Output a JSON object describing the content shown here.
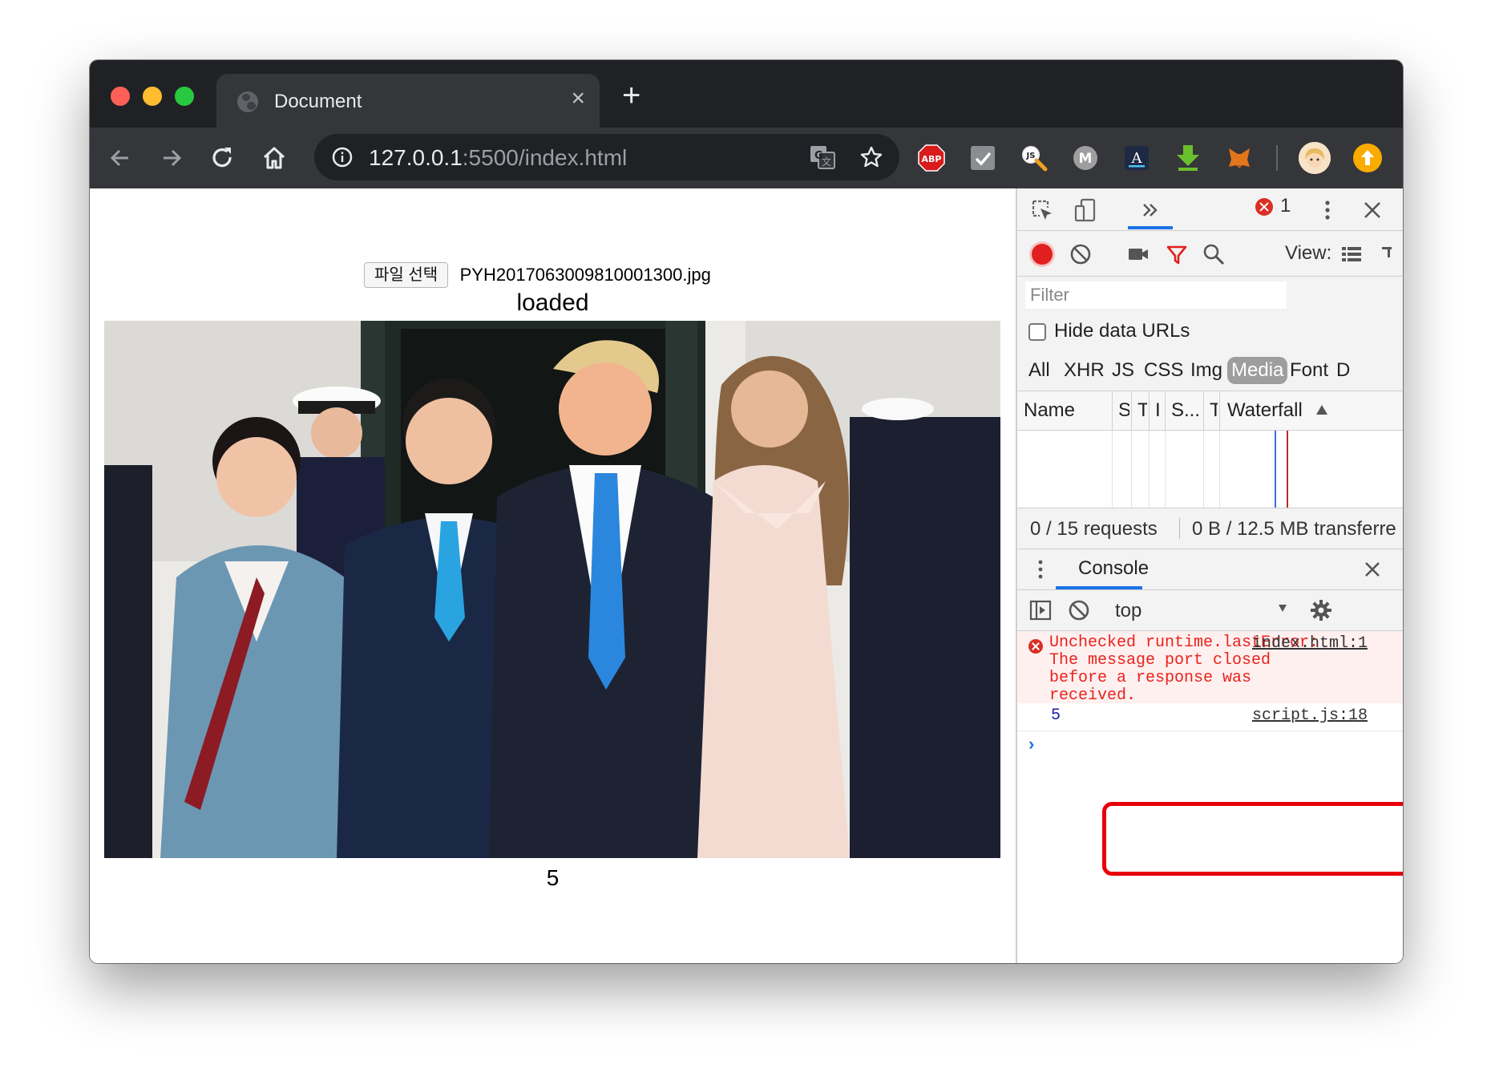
{
  "window": {
    "tab_title": "Document",
    "url_host": "127.0.0.1",
    "url_path": ":5500/index.html"
  },
  "extensions": {
    "abp_label": "ABP",
    "js_label": "JS",
    "m_label": "M",
    "a_label": "A"
  },
  "page": {
    "file_button_label": "파일 선택",
    "file_name": "PYH2017063009810001300.jpg",
    "status_text": "loaded",
    "count_value": "5"
  },
  "devtools": {
    "error_count": "1",
    "network": {
      "filter_placeholder": "Filter",
      "view_label": "View:",
      "hide_data_urls_label": "Hide data URLs",
      "types": [
        "All",
        "XHR",
        "JS",
        "CSS",
        "Img",
        "Media",
        "Font",
        "D"
      ],
      "active_type": "Media",
      "columns": [
        "Name",
        "S",
        "T",
        "I",
        "S...",
        "T",
        "Waterfall"
      ],
      "requests": "0 / 15 requests",
      "transferred": "0 B / 12.5 MB transferre"
    },
    "console": {
      "tab_label": "Console",
      "context": "top",
      "error_message": "Unchecked runtime.lastError: The message port closed before a response was received.",
      "error_source": "index.html:1",
      "log_value": "5",
      "log_source": "script.js:18",
      "prompt": "›"
    }
  },
  "colors": {
    "tab_strip": "#202124",
    "toolbar": "#35363a",
    "highlight_border": "#e8000a",
    "error_text": "#e8231d",
    "accent_blue": "#1a73e8"
  }
}
